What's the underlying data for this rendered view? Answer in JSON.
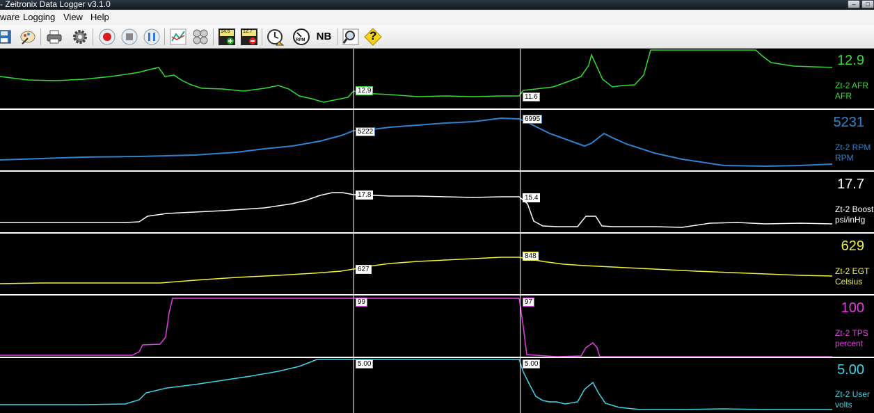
{
  "window": {
    "title": "- Zeitronix Data Logger v3.1.0",
    "min": "–",
    "max": "□"
  },
  "menu": [
    "ware",
    "Logging",
    "View",
    "Help"
  ],
  "toolbar": {
    "afr_badge": "14.5",
    "afr_badge2": "12.7",
    "nb_label": "NB",
    "rpm_label": "RPM",
    "help_label": "?"
  },
  "cursors": {
    "left_x_frac": 0.4045,
    "right_x_frac": 0.5955
  },
  "channels": [
    {
      "id": "afr",
      "current": "12.9",
      "name": "Zt-2 AFR",
      "unit": "AFR",
      "color": "#34dc34",
      "marker_a": "12.9",
      "marker_b": "11.6"
    },
    {
      "id": "rpm",
      "current": "5231",
      "name": "Zt-2 RPM",
      "unit": "RPM",
      "color": "#2f83cf",
      "marker_a": "5222",
      "marker_b": "6995"
    },
    {
      "id": "boost",
      "current": "17.7",
      "name": "Zt-2 Boost",
      "unit": "psi/inHg",
      "color": "#ffffff",
      "marker_a": "17.8",
      "marker_b": "15.4"
    },
    {
      "id": "egt",
      "current": "629",
      "name": "Zt-2 EGT",
      "unit": "Celsius",
      "color": "#f2f23a",
      "marker_a": "627",
      "marker_b": "848"
    },
    {
      "id": "tps",
      "current": "100",
      "name": "Zt-2 TPS",
      "unit": "percent",
      "color": "#e43ee4",
      "marker_a": "99",
      "marker_b": "97"
    },
    {
      "id": "user",
      "current": "5.00",
      "name": "Zt-2 User",
      "unit": "volts",
      "color": "#3fd6e6",
      "marker_a": "5.00",
      "marker_b": "5.00"
    }
  ]
}
